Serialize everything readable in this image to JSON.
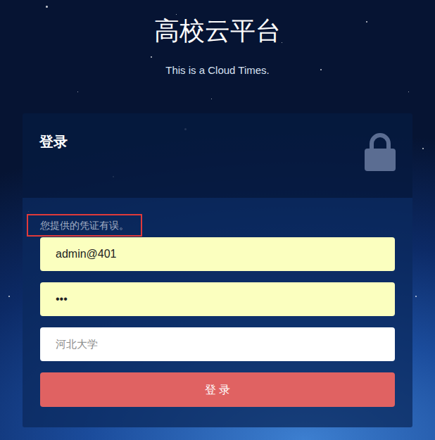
{
  "page": {
    "title": "高校云平台",
    "subtitle": "This is a Cloud Times."
  },
  "login": {
    "heading": "登录",
    "error": "您提供的凭证有误。",
    "fields": [
      {
        "name": "username",
        "value": "admin@401",
        "placeholder": "",
        "autofilled": true
      },
      {
        "name": "password",
        "value": "•••",
        "placeholder": "",
        "autofilled": true
      },
      {
        "name": "school",
        "value": "",
        "placeholder": "河北大学",
        "autofilled": false
      }
    ],
    "button": "登 录"
  }
}
